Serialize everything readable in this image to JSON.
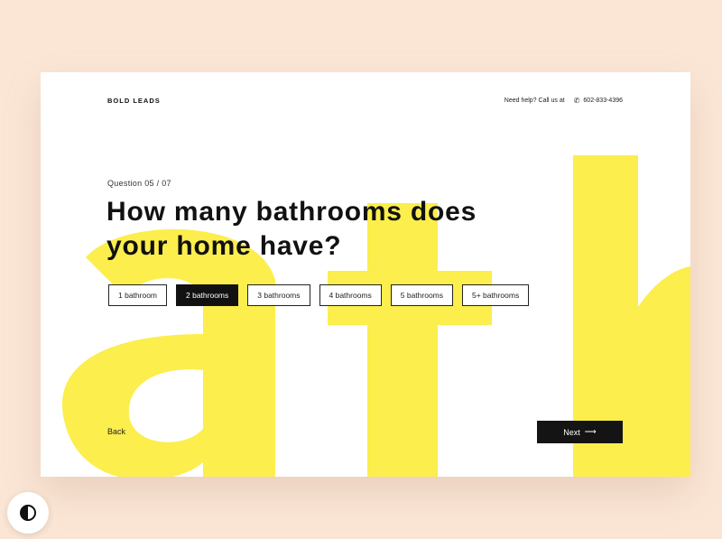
{
  "header": {
    "logo": "BOLD LEADS",
    "help_text": "Need help? Call us at",
    "phone_icon": "phone-icon",
    "phone": "602-833-4396"
  },
  "question": {
    "counter": "Question 05 / 07",
    "title": "How many bathrooms does your home have?"
  },
  "options": [
    {
      "label": "1 bathroom",
      "selected": false
    },
    {
      "label": "2 bathrooms",
      "selected": true
    },
    {
      "label": "3 bathrooms",
      "selected": false
    },
    {
      "label": "4 bathrooms",
      "selected": false
    },
    {
      "label": "5 bathrooms",
      "selected": false
    },
    {
      "label": "5+ bathrooms",
      "selected": false
    }
  ],
  "nav": {
    "back_label": "Back",
    "next_label": "Next",
    "next_icon": "arrow-right-icon"
  },
  "background": {
    "letters": "ath",
    "color": "#fcee4c"
  },
  "theme_toggle_icon": "contrast-icon",
  "colors": {
    "page_bg": "#fbe6d6",
    "card_bg": "#ffffff",
    "accent_yellow": "#fcee4c",
    "selected_bg": "#111111"
  }
}
